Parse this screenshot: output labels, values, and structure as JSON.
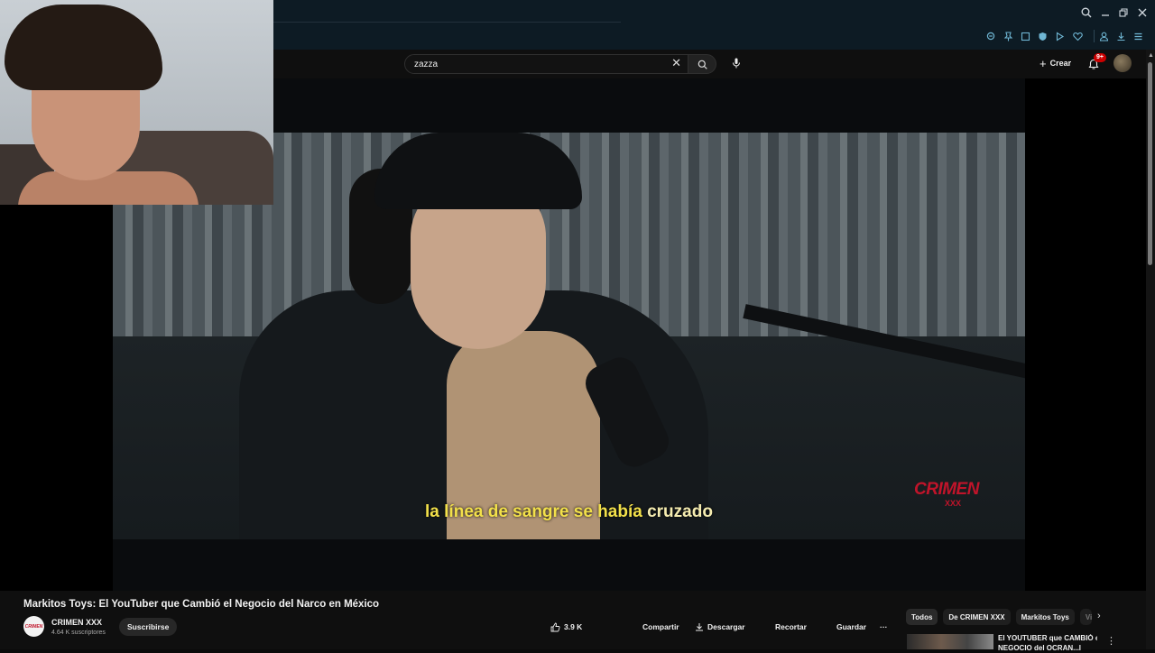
{
  "masthead": {
    "search_value": "zazza",
    "create_label": "Crear",
    "notification_count": "9+"
  },
  "player": {
    "subtitle_main": "la línea de sangre se había",
    "subtitle_highlight": "cruzado",
    "watermark": "CRIMEN",
    "watermark_sub": "XXX"
  },
  "video": {
    "title": "Markitos Toys: El YouTuber que Cambió el Negocio del Narco en México",
    "channel_name": "CRIMEN XXX",
    "channel_avatar_text": "CRIMEN",
    "subscribers": "4.64 K suscriptores",
    "subscribe_label": "Suscribirse",
    "like_count": "3.9 K",
    "share_label": "Compartir",
    "download_label": "Descargar",
    "clip_label": "Recortar",
    "save_label": "Guardar",
    "more_label": "···"
  },
  "related": {
    "chips": [
      "Todos",
      "De CRIMEN XXX",
      "Markitos Toys",
      "Vi"
    ],
    "first_title_line1": "El YOUTUBER que CAMBIÓ el",
    "first_title_line2": "NEGOCIO del OCRAN...l"
  },
  "colors": {
    "subtitle": "#f2e04a",
    "watermark": "#c0142a",
    "browser_chrome": "#0d1b24",
    "toolbar_icons": "#6fb6d3"
  },
  "icons": {
    "window": [
      "search-icon",
      "minimize-icon",
      "restore-icon",
      "close-icon"
    ],
    "toolbar": [
      "zoom-icon",
      "pin-icon",
      "reader-icon",
      "shield-icon",
      "play-icon",
      "heart-icon",
      "account-icon",
      "download-icon",
      "menu-icon"
    ]
  }
}
